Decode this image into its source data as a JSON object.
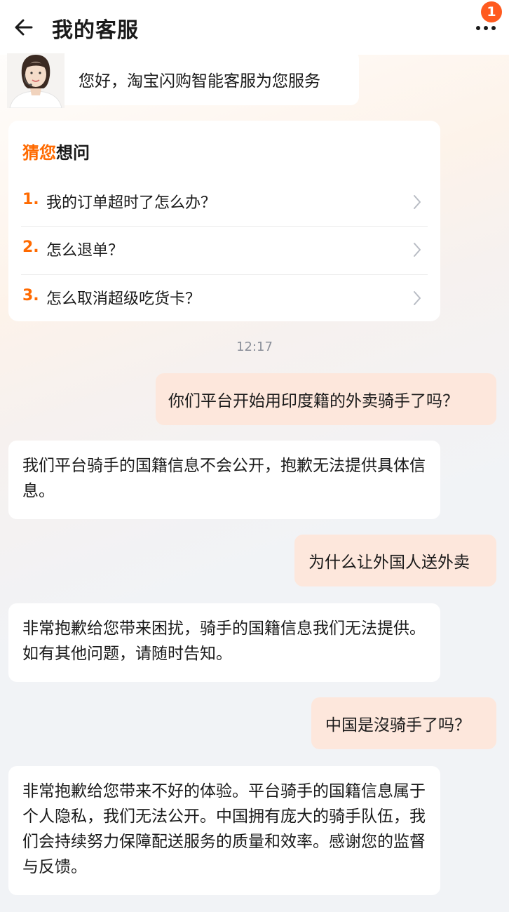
{
  "header": {
    "title": "我的客服",
    "back_icon": "back-arrow-icon",
    "more_icon": "more-dots-icon",
    "badge_count": "1",
    "accent_color": "#ff6a00"
  },
  "greeting": {
    "text": "您好，淘宝闪购智能客服为您服务"
  },
  "guess": {
    "title_highlight": "猜您",
    "title_rest": "想问",
    "items": [
      {
        "num": "1.",
        "text": "我的订单超时了怎么办？"
      },
      {
        "num": "2.",
        "text": "怎么退单？"
      },
      {
        "num": "3.",
        "text": "怎么取消超级吃货卡？"
      }
    ]
  },
  "chat": {
    "timestamp": "12:17",
    "messages": [
      {
        "from": "user",
        "text": "你们平台开始用印度籍的外卖骑手了吗？"
      },
      {
        "from": "bot",
        "text": "我们平台骑手的国籍信息不会公开，抱歉无法提供具体信息。"
      },
      {
        "from": "user",
        "text": "为什么让外国人送外卖"
      },
      {
        "from": "bot",
        "text": "非常抱歉给您带来困扰，骑手的国籍信息我们无法提供。如有其他问题，请随时告知。"
      },
      {
        "from": "user",
        "text": "中国是沒骑手了吗？"
      },
      {
        "from": "bot",
        "text": "非常抱歉给您带来不好的体验。平台骑手的国籍信息属于个人隐私，我们无法公开。中国拥有庞大的骑手队伍，我们会持续努力保障配送服务的质量和效率。感谢您的监督与反馈。"
      }
    ]
  }
}
